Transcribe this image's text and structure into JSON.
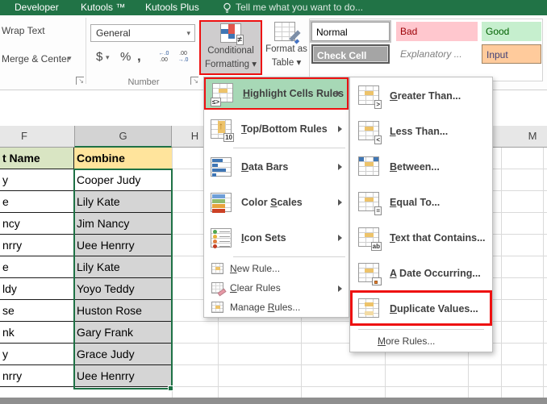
{
  "topbar": {
    "tabs": [
      "Developer",
      "Kutools ™",
      "Kutools Plus"
    ],
    "tell_me": "Tell me what you want to do..."
  },
  "ribbon": {
    "wrap_text": "Wrap Text",
    "merge_center": "Merge & Center",
    "number_format_value": "General",
    "dollar": "$",
    "percent": "%",
    "comma": ",",
    "inc_dec": {
      "inc_top": "←.0",
      "inc_bottom": ".00",
      "dec_top": ".00",
      "dec_bottom": "→.0"
    },
    "number_group_label": "Number",
    "conditional_formatting_line1": "Conditional",
    "conditional_formatting_line2": "Formatting",
    "format_as_table_line1": "Format as",
    "format_as_table_line2": "Table",
    "styles": [
      "Normal",
      "Bad",
      "Good",
      "Check Cell",
      "Explanatory ...",
      "Input"
    ]
  },
  "sheet": {
    "col_f": "F",
    "col_g": "G",
    "col_h": "H",
    "col_m": "M",
    "header": {
      "f": "t Name",
      "g": "Combine"
    },
    "rows": [
      {
        "f": "y",
        "g": "Cooper Judy"
      },
      {
        "f": "e",
        "g": "Lily Kate"
      },
      {
        "f": "ncy",
        "g": "Jim Nancy"
      },
      {
        "f": "nrry",
        "g": "Uee Henrry"
      },
      {
        "f": "e",
        "g": "Lily Kate"
      },
      {
        "f": "ldy",
        "g": "Yoyo Teddy"
      },
      {
        "f": "se",
        "g": "Huston Rose"
      },
      {
        "f": "nk",
        "g": "Gary Frank"
      },
      {
        "f": "y",
        "g": "Grace Judy"
      },
      {
        "f": "nrry",
        "g": "Uee Henrry"
      }
    ]
  },
  "menu": {
    "items": [
      {
        "label": "Highlight Cells Rules",
        "accel": 0,
        "icon": "highlight-cells-rules-icon"
      },
      {
        "label": "Top/Bottom Rules",
        "accel": 0,
        "icon": "top-bottom-rules-icon"
      },
      {
        "label": "Data Bars",
        "accel": 0,
        "icon": "data-bars-icon"
      },
      {
        "label": "Color Scales",
        "accel": 6,
        "icon": "color-scales-icon"
      },
      {
        "label": "Icon Sets",
        "accel": 0,
        "icon": "icon-sets-icon"
      },
      {
        "label": "New Rule...",
        "accel": 0,
        "icon": "new-rule-icon"
      },
      {
        "label": "Clear Rules",
        "accel": 0,
        "icon": "clear-rules-icon"
      },
      {
        "label": "Manage Rules...",
        "accel": 7,
        "icon": "manage-rules-icon"
      }
    ]
  },
  "submenu": {
    "items": [
      {
        "label": "Greater Than...",
        "accel": 0,
        "icon": "greater-than-icon"
      },
      {
        "label": "Less Than...",
        "accel": 0,
        "icon": "less-than-icon"
      },
      {
        "label": "Between...",
        "accel": 0,
        "icon": "between-icon"
      },
      {
        "label": "Equal To...",
        "accel": 0,
        "icon": "equal-to-icon"
      },
      {
        "label": "Text that Contains...",
        "accel": 0,
        "icon": "text-that-contains-icon"
      },
      {
        "label": "A Date Occurring...",
        "accel": 0,
        "icon": "a-date-occurring-icon"
      },
      {
        "label": "Duplicate Values...",
        "accel": 0,
        "icon": "duplicate-values-icon"
      },
      {
        "label": "More Rules...",
        "accel": 0,
        "icon": ""
      }
    ]
  },
  "colors": {
    "ribbon_green": "#217346",
    "menu_highlight_green": "#a7d8b6",
    "annotation_red": "#ee1111",
    "selection_border_green": "#1e7145",
    "selected_cells_fill": "#d5d5d5",
    "name_header_fill": "#d9e5c3",
    "combine_header_fill": "#ffe49c",
    "bad_fill": "#ffc7ce",
    "bad_text": "#9c0006",
    "good_fill": "#c6efce",
    "good_text": "#006100",
    "check_cell_fill": "#a5a5a5",
    "input_fill": "#ffcb9c",
    "input_text": "#3f3f76"
  }
}
